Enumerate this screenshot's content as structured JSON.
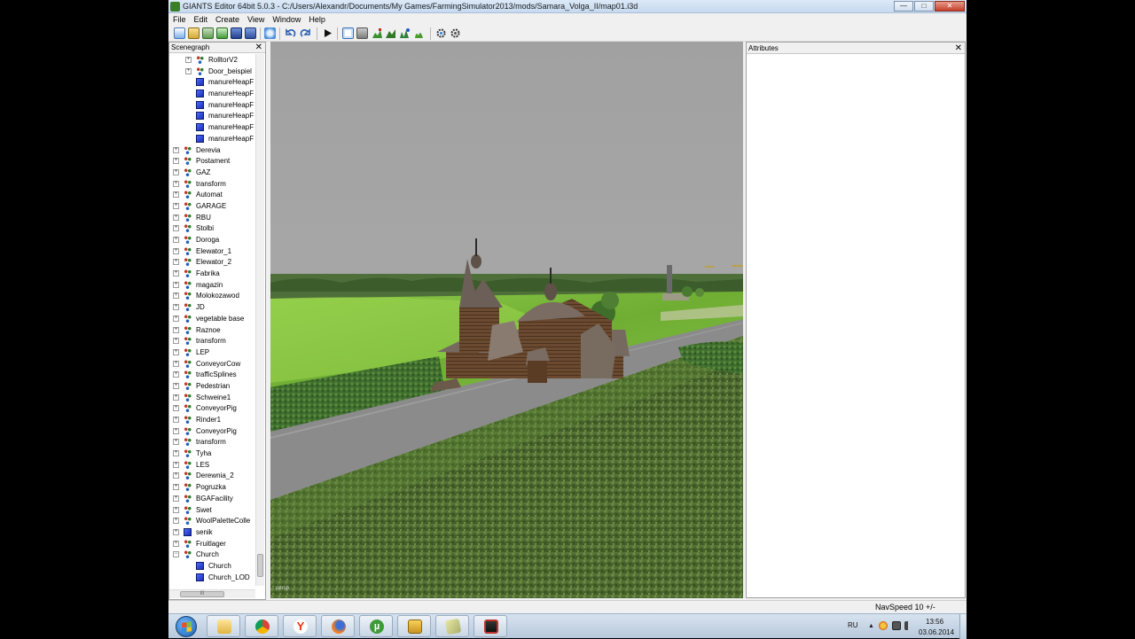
{
  "window": {
    "title": "GIANTS Editor 64bit 5.0.3 - C:/Users/Alexandr/Documents/My Games/FarmingSimulator2013/mods/Samara_Volga_II/map01.i3d",
    "buttons": {
      "minimize": "—",
      "maximize": "□",
      "close": "✕"
    }
  },
  "menu": [
    "File",
    "Edit",
    "Create",
    "View",
    "Window",
    "Help"
  ],
  "toolbar": {
    "icons": [
      "new-icon",
      "open-icon",
      "import-icon",
      "export-icon",
      "save-icon",
      "save-all-icon",
      "refresh-icon",
      "undo-icon",
      "redo-icon",
      "play-icon",
      "select-mode-icon",
      "move-mode-icon",
      "terrain-paint-icon",
      "terrain-sculpt-icon",
      "foliage-icon",
      "vegetation-icon",
      "gear-icon",
      "settings-icon"
    ]
  },
  "scenegraph": {
    "title": "Scenegraph",
    "close": "✕",
    "items": [
      {
        "label": "RolltorV2",
        "level": 1,
        "icon": "transform",
        "expand": "+"
      },
      {
        "label": "Door_beispiel",
        "level": 1,
        "icon": "transform",
        "expand": "+"
      },
      {
        "label": "manureHeapF",
        "level": 1,
        "icon": "shape",
        "expand": ""
      },
      {
        "label": "manureHeapF",
        "level": 1,
        "icon": "shape",
        "expand": ""
      },
      {
        "label": "manureHeapF",
        "level": 1,
        "icon": "shape",
        "expand": ""
      },
      {
        "label": "manureHeapF",
        "level": 1,
        "icon": "shape",
        "expand": ""
      },
      {
        "label": "manureHeapF",
        "level": 1,
        "icon": "shape",
        "expand": ""
      },
      {
        "label": "manureHeapF",
        "level": 1,
        "icon": "shape",
        "expand": ""
      },
      {
        "label": "Derevia",
        "level": 0,
        "icon": "transform",
        "expand": "+"
      },
      {
        "label": "Postament",
        "level": 0,
        "icon": "transform",
        "expand": "+"
      },
      {
        "label": "GAZ",
        "level": 0,
        "icon": "transform",
        "expand": "+"
      },
      {
        "label": "transform",
        "level": 0,
        "icon": "transform",
        "expand": "+"
      },
      {
        "label": "Automat",
        "level": 0,
        "icon": "transform",
        "expand": "+"
      },
      {
        "label": "GARAGE",
        "level": 0,
        "icon": "transform",
        "expand": "+"
      },
      {
        "label": "RBU",
        "level": 0,
        "icon": "transform",
        "expand": "+"
      },
      {
        "label": "Stolbi",
        "level": 0,
        "icon": "transform",
        "expand": "+"
      },
      {
        "label": "Doroga",
        "level": 0,
        "icon": "transform",
        "expand": "+"
      },
      {
        "label": "Elewator_1",
        "level": 0,
        "icon": "transform",
        "expand": "+"
      },
      {
        "label": "Elewator_2",
        "level": 0,
        "icon": "transform",
        "expand": "+"
      },
      {
        "label": "Fabrika",
        "level": 0,
        "icon": "transform",
        "expand": "+"
      },
      {
        "label": "magazin",
        "level": 0,
        "icon": "transform",
        "expand": "+"
      },
      {
        "label": "Molokozawod",
        "level": 0,
        "icon": "transform",
        "expand": "+"
      },
      {
        "label": "JD",
        "level": 0,
        "icon": "transform",
        "expand": "+"
      },
      {
        "label": "vegetable base",
        "level": 0,
        "icon": "transform",
        "expand": "+"
      },
      {
        "label": "Raznoe",
        "level": 0,
        "icon": "transform",
        "expand": "+"
      },
      {
        "label": "transform",
        "level": 0,
        "icon": "transform",
        "expand": "+"
      },
      {
        "label": "LEP",
        "level": 0,
        "icon": "transform",
        "expand": "+"
      },
      {
        "label": "ConveyorCow",
        "level": 0,
        "icon": "transform",
        "expand": "+"
      },
      {
        "label": "trafficSplines",
        "level": 0,
        "icon": "transform",
        "expand": "+"
      },
      {
        "label": "Pedestrian",
        "level": 0,
        "icon": "transform",
        "expand": "+"
      },
      {
        "label": "Schweine1",
        "level": 0,
        "icon": "transform",
        "expand": "+"
      },
      {
        "label": "ConveyorPig",
        "level": 0,
        "icon": "transform",
        "expand": "+"
      },
      {
        "label": "Rinder1",
        "level": 0,
        "icon": "transform",
        "expand": "+"
      },
      {
        "label": "ConveyorPig",
        "level": 0,
        "icon": "transform",
        "expand": "+"
      },
      {
        "label": "transform",
        "level": 0,
        "icon": "transform",
        "expand": "+"
      },
      {
        "label": "Tyha",
        "level": 0,
        "icon": "transform",
        "expand": "+"
      },
      {
        "label": "LES",
        "level": 0,
        "icon": "transform",
        "expand": "+"
      },
      {
        "label": "Derewnia_2",
        "level": 0,
        "icon": "transform",
        "expand": "+"
      },
      {
        "label": "Pogruzka",
        "level": 0,
        "icon": "transform",
        "expand": "+"
      },
      {
        "label": "BGAFacility",
        "level": 0,
        "icon": "transform",
        "expand": "+"
      },
      {
        "label": "Swet",
        "level": 0,
        "icon": "transform",
        "expand": "+"
      },
      {
        "label": "WoolPaletteColle",
        "level": 0,
        "icon": "transform",
        "expand": "+"
      },
      {
        "label": "senik",
        "level": 0,
        "icon": "shape",
        "expand": "+"
      },
      {
        "label": "Fruitlager",
        "level": 0,
        "icon": "transform",
        "expand": "+"
      },
      {
        "label": "Church",
        "level": 0,
        "icon": "transform",
        "expand": "−"
      },
      {
        "label": "Church",
        "level": 1,
        "icon": "shape",
        "expand": ""
      },
      {
        "label": "Church_LOD",
        "level": 1,
        "icon": "shape",
        "expand": ""
      }
    ],
    "hscroll_grip": "III"
  },
  "viewport": {
    "corner_label": "persp",
    "colors": {
      "sky": "#a3a3a3",
      "grass": "#78b43a",
      "road": "#8a8a8a",
      "crops": "#4f6b2e"
    }
  },
  "attributes": {
    "title": "Attributes",
    "close": "✕"
  },
  "status": {
    "nav_speed": "NavSpeed 10 +/-"
  },
  "taskbar": {
    "apps": [
      "file-explorer",
      "chrome",
      "yandex-browser",
      "firefox",
      "utorrent",
      "folder-app",
      "notes-app",
      "recorder-app"
    ],
    "tray": {
      "language": "RU",
      "overflow": "▲",
      "time": "13:56",
      "date": "03.06.2014"
    }
  }
}
